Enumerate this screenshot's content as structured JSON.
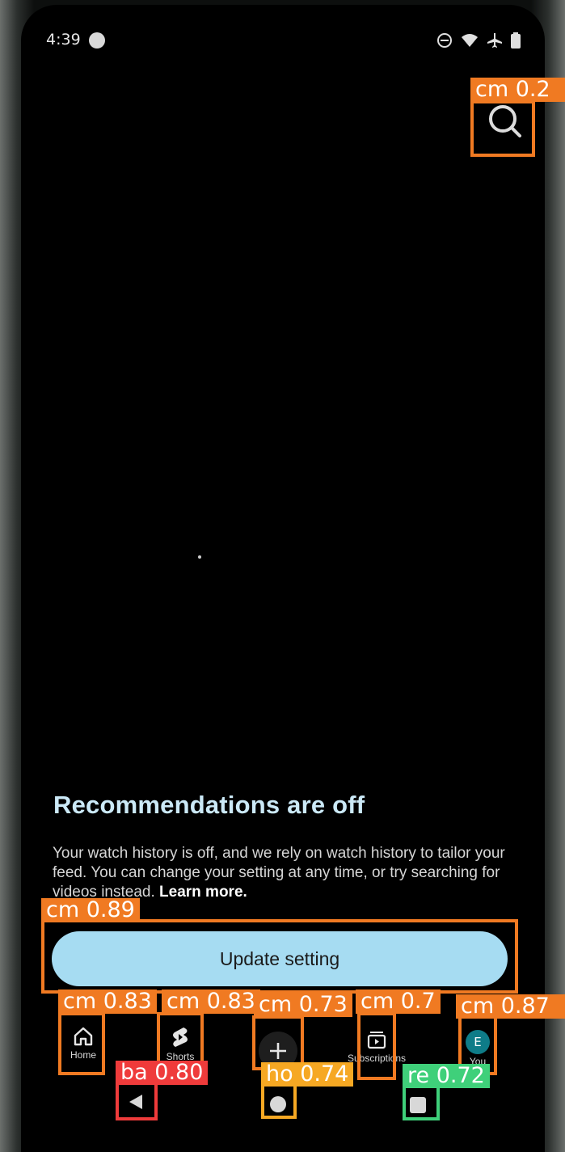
{
  "status_bar": {
    "time": "4:39",
    "icons": [
      "do-not-disturb-icon",
      "wifi-icon",
      "airplane-mode-icon",
      "battery-icon"
    ]
  },
  "header": {
    "search_icon": "search-icon"
  },
  "content": {
    "title": "Recommendations are off",
    "body": "Your watch history is off, and we rely on watch history to tailor your feed. You can change your setting at any time, or try searching for videos instead.",
    "learn_more": "Learn more.",
    "button_label": "Update setting"
  },
  "bottom_nav": {
    "items": [
      {
        "label": "Home",
        "icon": "home-icon"
      },
      {
        "label": "Shorts",
        "icon": "shorts-icon"
      },
      {
        "label": "",
        "icon": "create-plus-icon"
      },
      {
        "label": "Subscriptions",
        "icon": "subscriptions-icon"
      },
      {
        "label": "You",
        "icon": "avatar",
        "avatar_letter": "E"
      }
    ]
  },
  "system_nav": {
    "items": [
      "back-icon",
      "home-circle-icon",
      "recents-square-icon"
    ]
  },
  "detections": [
    {
      "label": "cm  0.2",
      "color": "#f07a22"
    },
    {
      "label": "cm  0.89",
      "color": "#f07a22"
    },
    {
      "label": "cm  0.83",
      "color": "#f07a22"
    },
    {
      "label": "cm  0.83",
      "color": "#f07a22"
    },
    {
      "label": "cm  0.73",
      "color": "#f07a22"
    },
    {
      "label": "cm  0.7",
      "color": "#f07a22"
    },
    {
      "label": "cm  0.87",
      "color": "#f07a22"
    },
    {
      "label": "ba  0.80",
      "color": "#ef3b3b"
    },
    {
      "label": "ho  0.74",
      "color": "#f6a823"
    },
    {
      "label": "re  0.72",
      "color": "#3fd07a"
    }
  ]
}
